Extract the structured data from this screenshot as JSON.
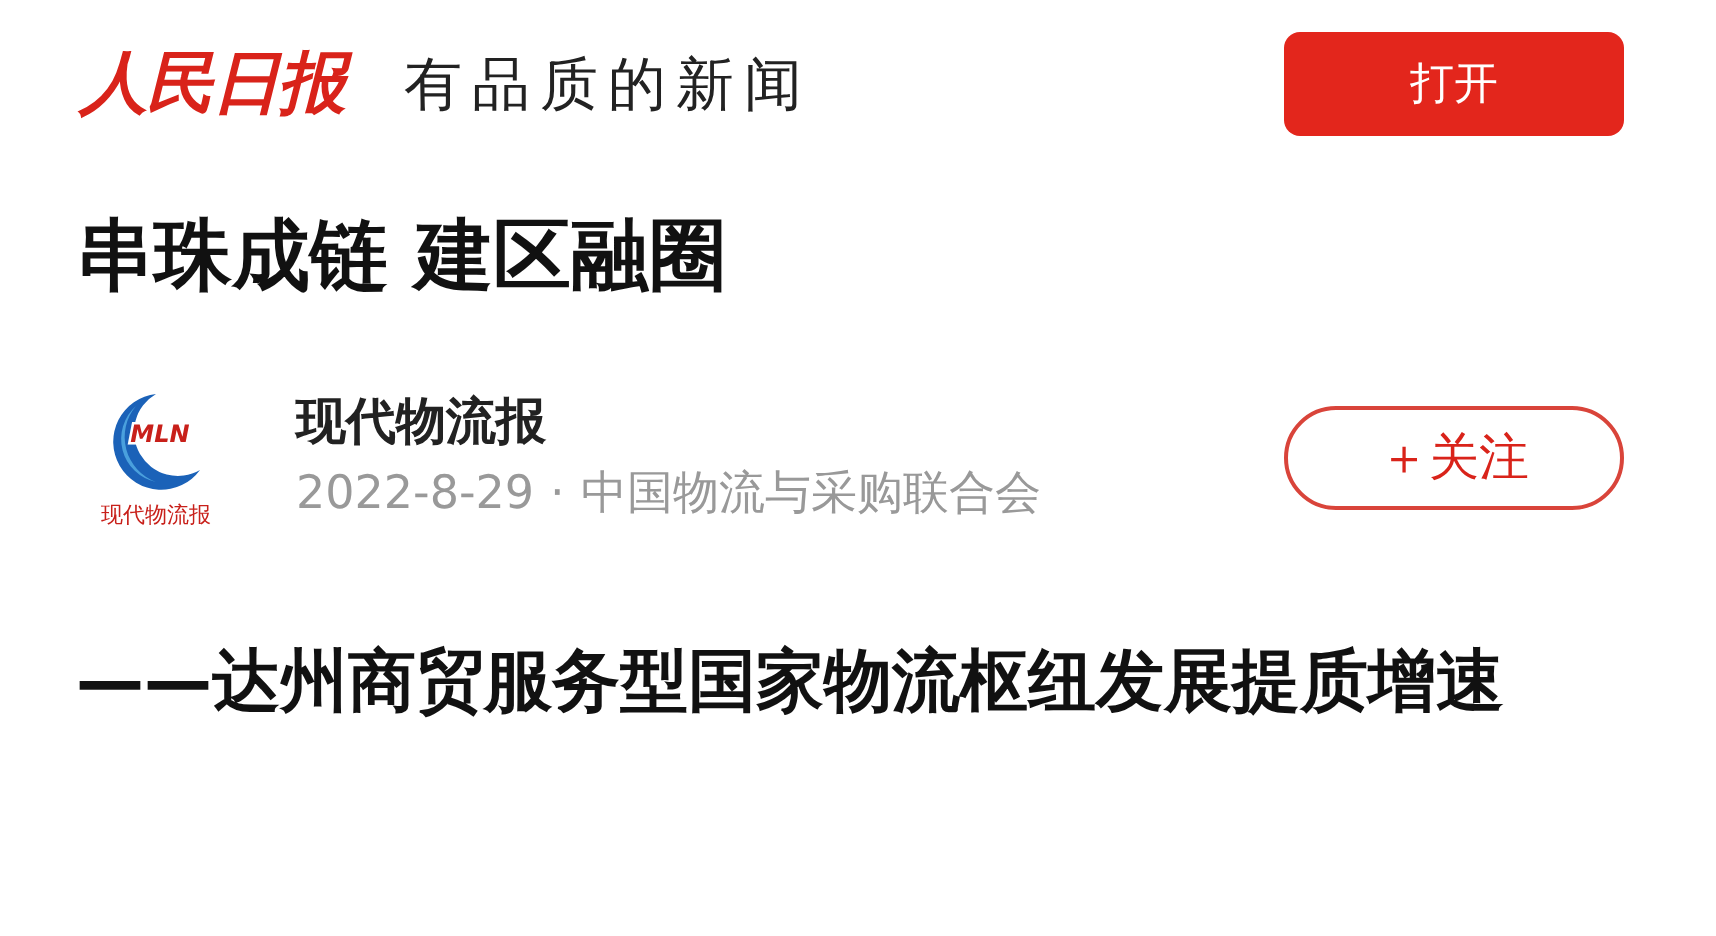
{
  "header": {
    "logo": "人民日报",
    "tagline": "有品质的新闻",
    "open_button": "打开"
  },
  "article": {
    "title": "串珠成链 建区融圈",
    "author": {
      "logo_text": "MLN",
      "logo_caption": "现代物流报",
      "name": "现代物流报",
      "date": "2022-8-29",
      "separator": "·",
      "source": "中国物流与采购联合会",
      "follow_button": "＋关注"
    },
    "subtitle": "——达州商贸服务型国家物流枢纽发展提质增速"
  }
}
